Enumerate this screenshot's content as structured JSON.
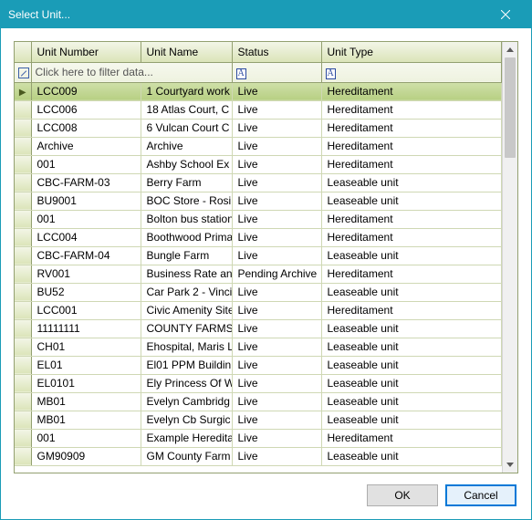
{
  "window": {
    "title": "Select Unit..."
  },
  "columns": {
    "unit_number": "Unit Number",
    "unit_name": "Unit Name",
    "status": "Status",
    "unit_type": "Unit Type"
  },
  "filter": {
    "placeholder": "Click here to filter data...",
    "type_marker": "A"
  },
  "rows": [
    {
      "selected": true,
      "num": "LCC009",
      "name": "1 Courtyard work",
      "status": "Live",
      "type": "Hereditament"
    },
    {
      "selected": false,
      "num": "LCC006",
      "name": "18 Atlas Court, C",
      "status": "Live",
      "type": "Hereditament"
    },
    {
      "selected": false,
      "num": "LCC008",
      "name": "6 Vulcan Court C",
      "status": "Live",
      "type": "Hereditament"
    },
    {
      "selected": false,
      "num": "Archive",
      "name": "Archive",
      "status": "Live",
      "type": "Hereditament"
    },
    {
      "selected": false,
      "num": "001",
      "name": "Ashby School Ex",
      "status": "Live",
      "type": "Hereditament"
    },
    {
      "selected": false,
      "num": "CBC-FARM-03",
      "name": "Berry Farm",
      "status": "Live",
      "type": "Leaseable unit"
    },
    {
      "selected": false,
      "num": "BU9001",
      "name": "BOC Store - Rosi",
      "status": "Live",
      "type": "Leaseable unit"
    },
    {
      "selected": false,
      "num": "001",
      "name": "Bolton bus station",
      "status": "Live",
      "type": "Hereditament"
    },
    {
      "selected": false,
      "num": "LCC004",
      "name": "Boothwood Prima",
      "status": "Live",
      "type": "Hereditament"
    },
    {
      "selected": false,
      "num": "CBC-FARM-04",
      "name": "Bungle Farm",
      "status": "Live",
      "type": "Leaseable unit"
    },
    {
      "selected": false,
      "num": "RV001",
      "name": "Business Rate an",
      "status": "Pending Archive",
      "type": "Hereditament"
    },
    {
      "selected": false,
      "num": "BU52",
      "name": "Car Park 2 - Vinci",
      "status": "Live",
      "type": "Leaseable unit"
    },
    {
      "selected": false,
      "num": "LCC001",
      "name": "Civic Amenity Site",
      "status": "Live",
      "type": "Hereditament"
    },
    {
      "selected": false,
      "num": "11111111",
      "name": "COUNTY FARMS",
      "status": "Live",
      "type": "Leaseable unit"
    },
    {
      "selected": false,
      "num": "CH01",
      "name": "Ehospital, Maris L",
      "status": "Live",
      "type": "Leaseable unit"
    },
    {
      "selected": false,
      "num": "EL01",
      "name": "El01 PPM Buildin",
      "status": "Live",
      "type": "Leaseable unit"
    },
    {
      "selected": false,
      "num": "EL0101",
      "name": "Ely Princess Of W",
      "status": "Live",
      "type": "Leaseable unit"
    },
    {
      "selected": false,
      "num": "MB01",
      "name": "Evelyn Cambridg",
      "status": "Live",
      "type": "Leaseable unit"
    },
    {
      "selected": false,
      "num": "MB01",
      "name": "Evelyn Cb Surgic",
      "status": "Live",
      "type": "Leaseable unit"
    },
    {
      "selected": false,
      "num": "001",
      "name": "Example Heredita",
      "status": "Live",
      "type": "Hereditament"
    },
    {
      "selected": false,
      "num": "GM90909",
      "name": "GM County Farm",
      "status": "Live",
      "type": "Leaseable unit"
    }
  ],
  "buttons": {
    "ok": "OK",
    "cancel": "Cancel"
  }
}
